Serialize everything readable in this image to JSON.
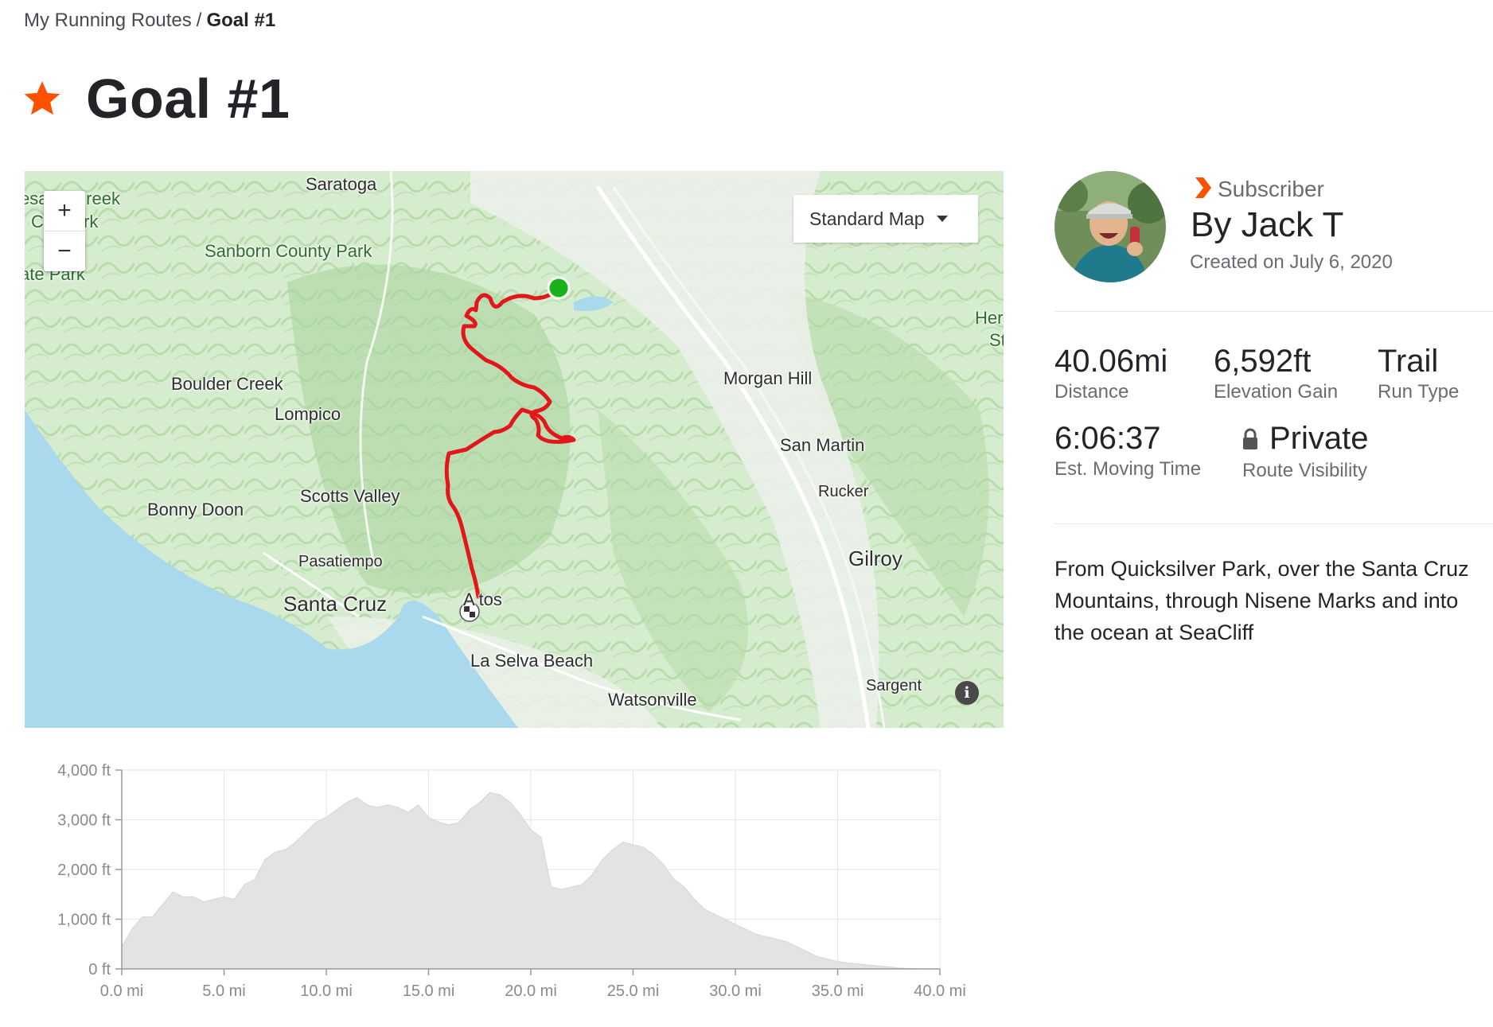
{
  "breadcrumb": {
    "parent": "My Running Routes",
    "separator": "/",
    "current": "Goal #1"
  },
  "header": {
    "title": "Goal #1",
    "star_icon": "star-icon",
    "accent_color": "#fc5200"
  },
  "map": {
    "map_type_label": "Standard Map",
    "zoom_in": "+",
    "zoom_out": "−",
    "info": "i",
    "route_color": "#e3161b",
    "start_marker_color": "#18b318",
    "labels": {
      "saratoga": "Saratoga",
      "creek_park_1": "esa   ro Creek",
      "creek_park_2": "C      y Park",
      "state_park": "ate Park",
      "sanborn": "Sanborn County Park",
      "boulder_creek": "Boulder Creek",
      "lompico": "Lompico",
      "bonny_doon": "Bonny Doon",
      "scotts_valley": "Scotts Valley",
      "pasatiempo": "Pasatiempo",
      "santa_cruz": "Santa Cruz",
      "aptos": "A  tos",
      "la_selva": "La Selva Beach",
      "watsonville": "Watsonville",
      "morgan_hill": "Morgan Hill",
      "san_martin": "San Martin",
      "rucker": "Rucker",
      "gilroy": "Gilroy",
      "sargent": "Sargent",
      "her": "Her",
      "st": "St"
    }
  },
  "athlete": {
    "badge_label": "Subscriber",
    "name": "By Jack T",
    "created": "Created on July 6, 2020"
  },
  "stats": {
    "distance": {
      "value": "40.06mi",
      "label": "Distance"
    },
    "elevation": {
      "value": "6,592ft",
      "label": "Elevation Gain"
    },
    "run_type": {
      "value": "Trail",
      "label": "Run Type"
    },
    "moving_time": {
      "value": "6:06:37",
      "label": "Est. Moving Time"
    },
    "visibility": {
      "value": "Private",
      "label": "Route Visibility"
    }
  },
  "description": "From Quicksilver Park, over the Santa Cruz Mountains, through Nisene Marks and into the ocean at SeaCliff",
  "chart_data": {
    "type": "area",
    "title": "",
    "xlabel": "",
    "ylabel": "",
    "xlim": [
      0,
      40
    ],
    "ylim": [
      0,
      4000
    ],
    "x_ticks": [
      "0.0 mi",
      "5.0 mi",
      "10.0 mi",
      "15.0 mi",
      "20.0 mi",
      "25.0 mi",
      "30.0 mi",
      "35.0 mi",
      "40.0 mi"
    ],
    "y_ticks": [
      "0 ft",
      "1,000 ft",
      "2,000 ft",
      "3,000 ft",
      "4,000 ft"
    ],
    "grid": true,
    "fill_color": "#e3e3e3",
    "x": [
      0,
      0.5,
      1,
      1.5,
      2,
      2.5,
      3,
      3.5,
      4,
      4.5,
      5,
      5.5,
      6,
      6.5,
      7,
      7.5,
      8,
      8.5,
      9,
      9.5,
      10,
      10.5,
      11,
      11.5,
      12,
      12.5,
      13,
      13.5,
      14,
      14.5,
      15,
      15.5,
      16,
      16.5,
      17,
      17.5,
      18,
      18.5,
      19,
      19.5,
      20,
      20.5,
      21,
      21.5,
      22,
      22.5,
      23,
      23.5,
      24,
      24.5,
      25,
      25.5,
      26,
      26.5,
      27,
      27.5,
      28,
      28.5,
      29,
      29.5,
      30,
      30.5,
      31,
      31.5,
      32,
      32.5,
      33,
      33.5,
      34,
      34.5,
      35,
      35.5,
      36,
      36.5,
      37,
      37.5,
      38,
      38.5,
      39,
      39.5,
      40
    ],
    "values": [
      450,
      800,
      1050,
      1050,
      1300,
      1550,
      1450,
      1450,
      1350,
      1400,
      1450,
      1400,
      1700,
      1800,
      2200,
      2350,
      2400,
      2550,
      2750,
      2950,
      3050,
      3200,
      3350,
      3450,
      3300,
      3250,
      3300,
      3250,
      3150,
      3300,
      3050,
      2950,
      2900,
      2950,
      3200,
      3350,
      3550,
      3500,
      3350,
      3100,
      2800,
      2650,
      1650,
      1600,
      1650,
      1700,
      1900,
      2200,
      2400,
      2550,
      2500,
      2450,
      2300,
      2100,
      1800,
      1650,
      1400,
      1200,
      1100,
      1000,
      900,
      800,
      700,
      650,
      600,
      550,
      450,
      350,
      250,
      200,
      150,
      120,
      100,
      80,
      60,
      40,
      20,
      10,
      0,
      0,
      0
    ]
  }
}
